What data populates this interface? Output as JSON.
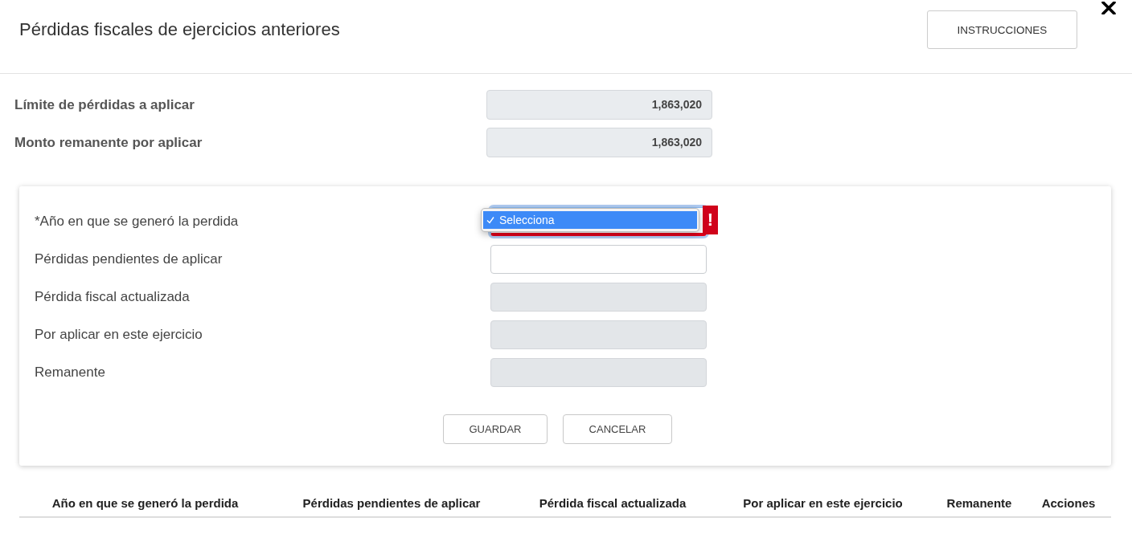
{
  "header": {
    "title": "Pérdidas fiscales de ejercicios anteriores",
    "instructions_button": "INSTRUCCIONES"
  },
  "summary": [
    {
      "label": "Límite de pérdidas a aplicar",
      "value": "1,863,020"
    },
    {
      "label": "Monto remanente por aplicar",
      "value": "1,863,020"
    }
  ],
  "form": {
    "fields": [
      {
        "kind": "select",
        "label": "*Año en que se generó la perdida",
        "invalid": true,
        "error_badge": "!",
        "open": true,
        "options": [
          {
            "label": "Selecciona",
            "selected": true
          }
        ]
      },
      {
        "kind": "input",
        "label": "Pérdidas pendientes de aplicar",
        "disabled": false
      },
      {
        "kind": "input",
        "label": "Pérdida fiscal actualizada",
        "disabled": true
      },
      {
        "kind": "input",
        "label": "Por aplicar en este ejercicio",
        "disabled": true
      },
      {
        "kind": "input",
        "label": "Remanente",
        "disabled": true
      }
    ],
    "buttons": [
      "GUARDAR",
      "CANCELAR"
    ]
  },
  "table": {
    "columns": [
      "Año en que se generó la perdida",
      "Pérdidas pendientes de aplicar",
      "Pérdida fiscal actualizada",
      "Por aplicar en este ejercicio",
      "Remanente",
      "Acciones"
    ]
  }
}
